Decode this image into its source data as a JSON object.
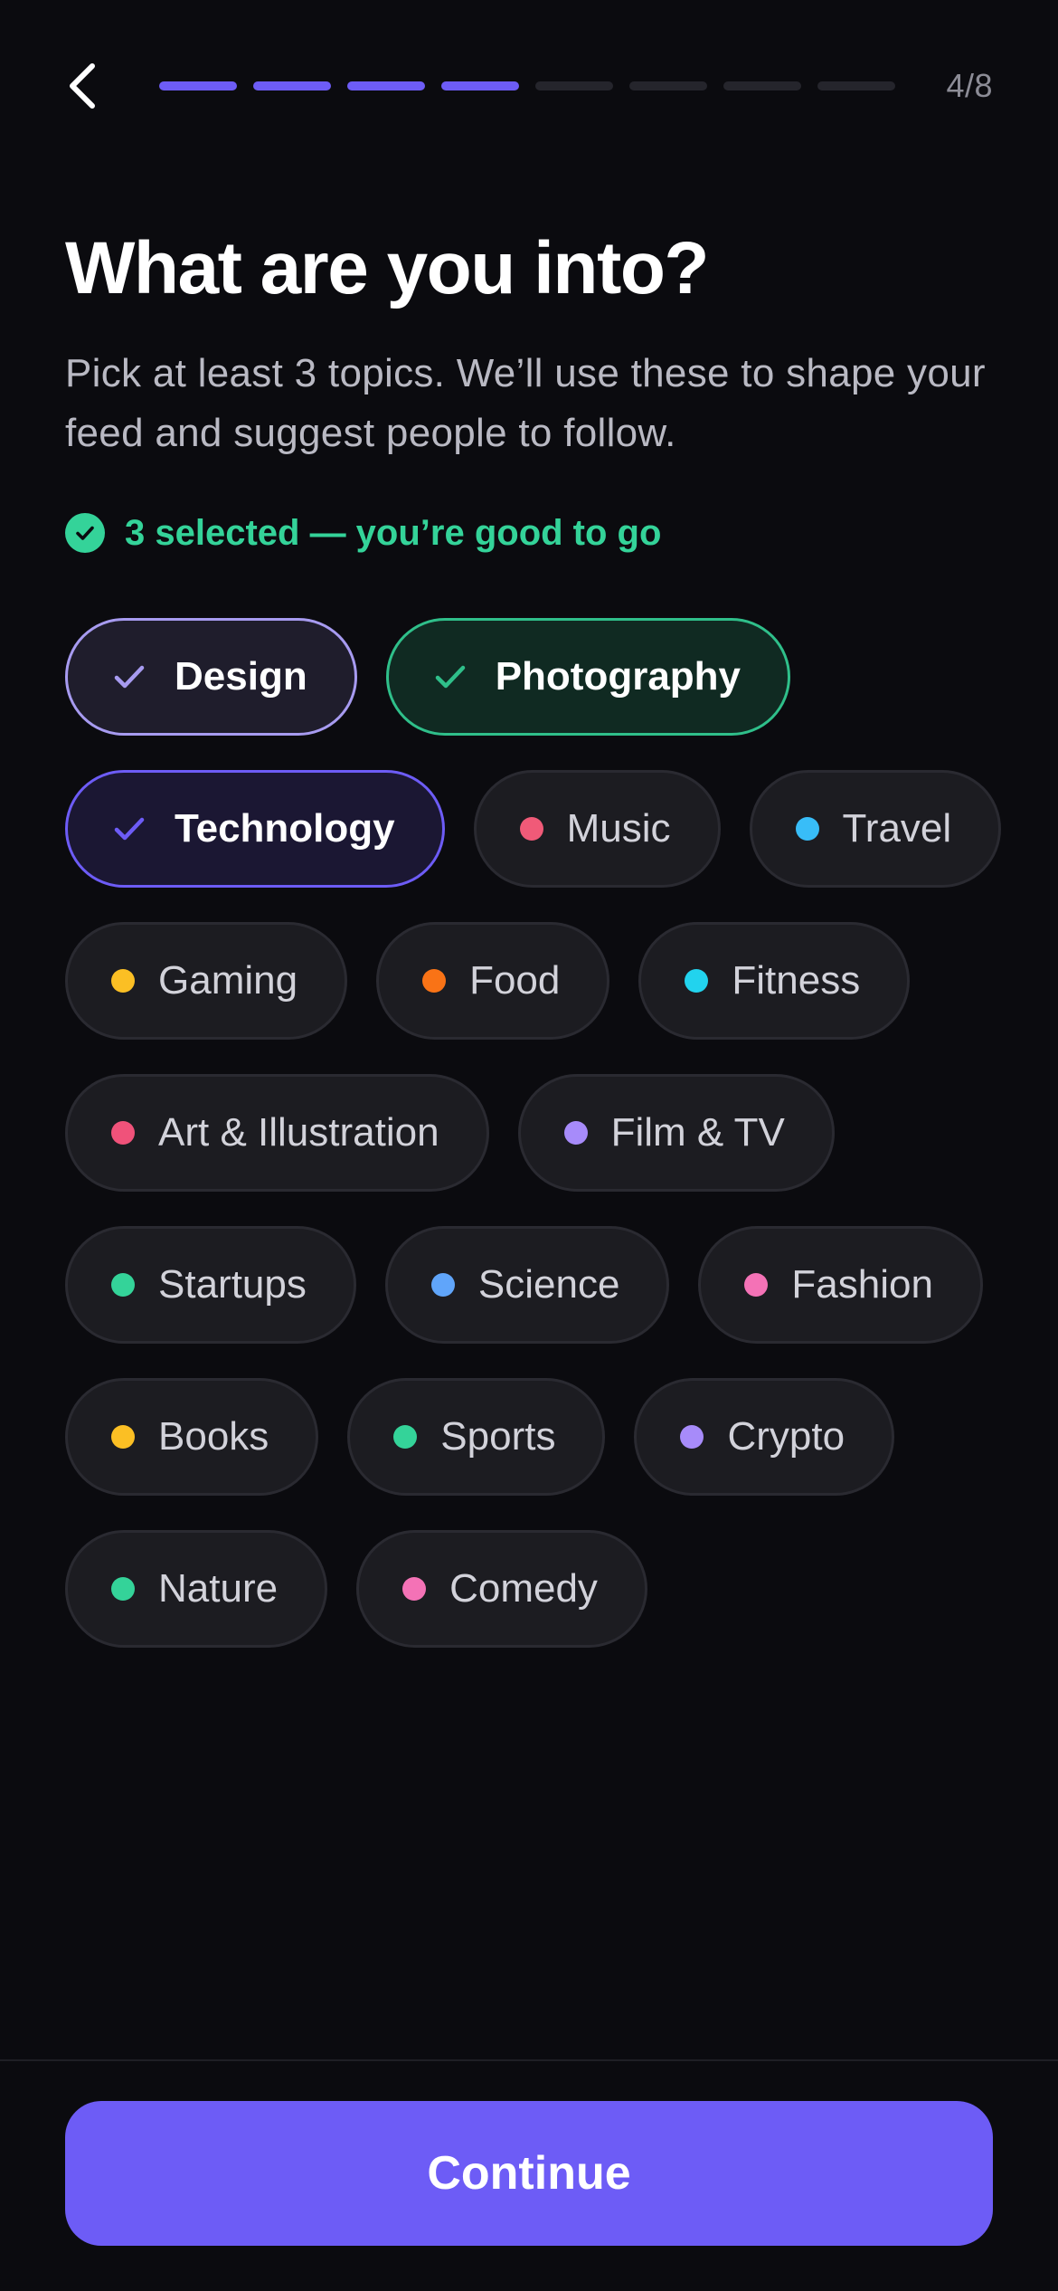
{
  "header": {
    "back_icon": "chevron-left-icon",
    "progress": {
      "current": 4,
      "total": 8
    },
    "step_label": "4/8",
    "accent_color": "#6d5cf6"
  },
  "title": "What are you into?",
  "subtitle": "Pick at least 3 topics. We’ll use these to shape your feed and suggest people to follow.",
  "status": {
    "icon": "check-circle-icon",
    "text": "3 selected — you’re good to go",
    "color": "#34d399"
  },
  "topics": [
    {
      "label": "Design",
      "selected": true,
      "color": "#a79bf0"
    },
    {
      "label": "Photography",
      "selected": true,
      "color": "#2fbf8a"
    },
    {
      "label": "Technology",
      "selected": true,
      "color": "#6d5cf6"
    },
    {
      "label": "Music",
      "selected": false,
      "color": "#f05a78"
    },
    {
      "label": "Travel",
      "selected": false,
      "color": "#38bdf8"
    },
    {
      "label": "Gaming",
      "selected": false,
      "color": "#fbbf24"
    },
    {
      "label": "Food",
      "selected": false,
      "color": "#f97316"
    },
    {
      "label": "Fitness",
      "selected": false,
      "color": "#22d3ee"
    },
    {
      "label": "Art & Illustration",
      "selected": false,
      "color": "#f0527a"
    },
    {
      "label": "Film & TV",
      "selected": false,
      "color": "#a78bfa"
    },
    {
      "label": "Startups",
      "selected": false,
      "color": "#34d399"
    },
    {
      "label": "Science",
      "selected": false,
      "color": "#60a5fa"
    },
    {
      "label": "Fashion",
      "selected": false,
      "color": "#f472b6"
    },
    {
      "label": "Books",
      "selected": false,
      "color": "#fbbf24"
    },
    {
      "label": "Sports",
      "selected": false,
      "color": "#34d399"
    },
    {
      "label": "Crypto",
      "selected": false,
      "color": "#a78bfa"
    },
    {
      "label": "Nature",
      "selected": false,
      "color": "#34d399"
    },
    {
      "label": "Comedy",
      "selected": false,
      "color": "#f472b6"
    }
  ],
  "footer": {
    "continue_label": "Continue"
  }
}
